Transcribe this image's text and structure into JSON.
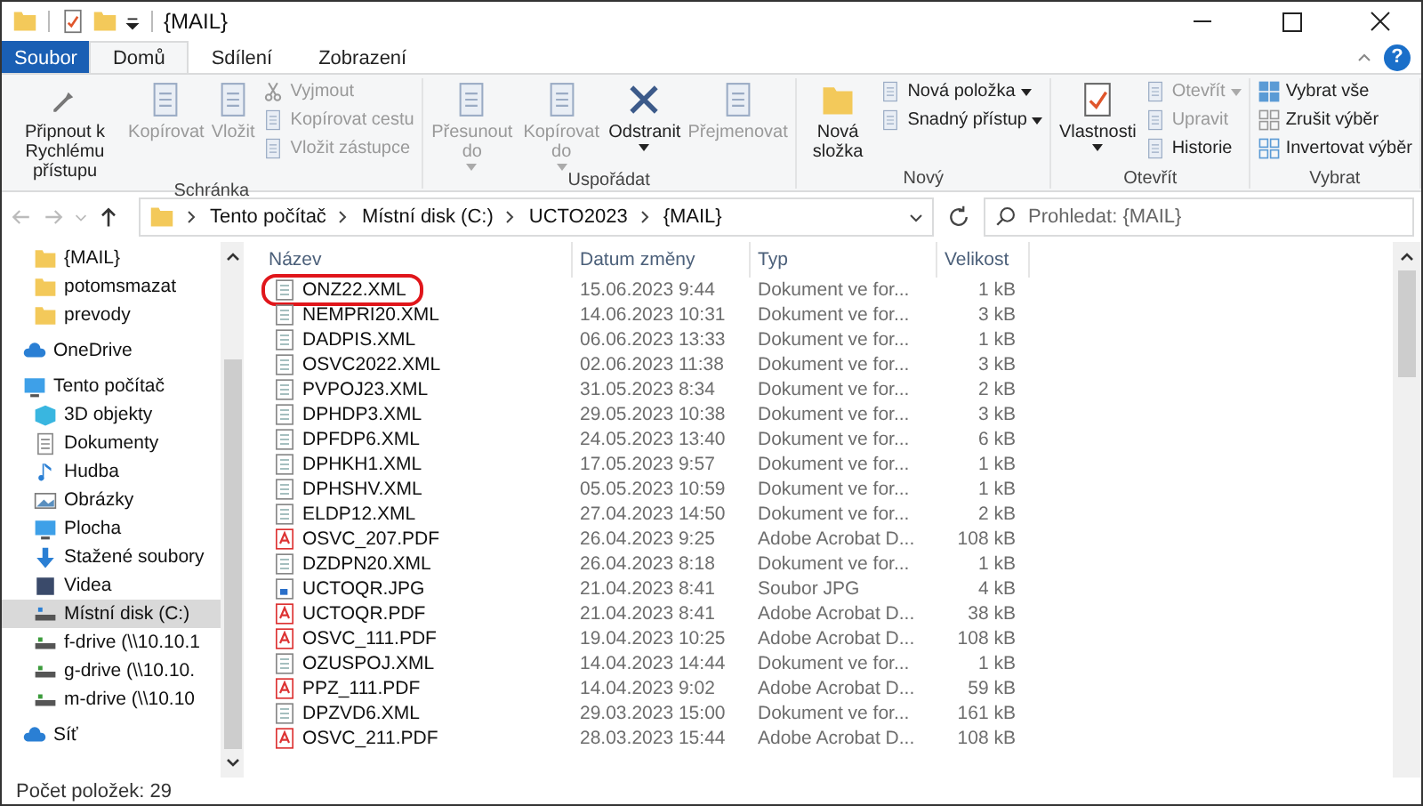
{
  "window": {
    "title": "{MAIL}"
  },
  "tabs": [
    {
      "label": "Soubor",
      "kind": "file",
      "selected": false
    },
    {
      "label": "Domů",
      "kind": "tab",
      "selected": true
    },
    {
      "label": "Sdílení",
      "kind": "tab",
      "selected": false
    },
    {
      "label": "Zobrazení",
      "kind": "tab",
      "selected": false
    }
  ],
  "help_button": "?",
  "ribbon": {
    "groups": [
      {
        "title": "Schránka",
        "items": [
          {
            "label": "Připnout k Rychlému přístupu",
            "kind": "large",
            "disabled": false,
            "dropdown": false
          },
          {
            "label": "Kopírovat",
            "kind": "large",
            "disabled": true,
            "dropdown": false
          },
          {
            "label": "Vložit",
            "kind": "large",
            "disabled": true,
            "dropdown": false
          },
          {
            "label": "Vyjmout",
            "kind": "small",
            "disabled": true,
            "dropdown": false
          },
          {
            "label": "Kopírovat cestu",
            "kind": "small",
            "disabled": true,
            "dropdown": false
          },
          {
            "label": "Vložit zástupce",
            "kind": "small",
            "disabled": true,
            "dropdown": false
          }
        ]
      },
      {
        "title": "Uspořádat",
        "items": [
          {
            "label": "Přesunout do",
            "kind": "large",
            "disabled": true,
            "dropdown": true
          },
          {
            "label": "Kopírovat do",
            "kind": "large",
            "disabled": true,
            "dropdown": true
          },
          {
            "label": "Odstranit",
            "kind": "large",
            "disabled": false,
            "dropdown": true
          },
          {
            "label": "Přejmenovat",
            "kind": "large",
            "disabled": true,
            "dropdown": false
          }
        ]
      },
      {
        "title": "Nový",
        "items": [
          {
            "label": "Nová složka",
            "kind": "large",
            "disabled": false,
            "dropdown": false
          },
          {
            "label": "Nová položka",
            "kind": "small",
            "disabled": false,
            "dropdown": true
          },
          {
            "label": "Snadný přístup",
            "kind": "small",
            "disabled": false,
            "dropdown": true
          }
        ]
      },
      {
        "title": "Otevřít",
        "items": [
          {
            "label": "Vlastnosti",
            "kind": "large",
            "disabled": false,
            "dropdown": true
          },
          {
            "label": "Otevřít",
            "kind": "small",
            "disabled": true,
            "dropdown": true
          },
          {
            "label": "Upravit",
            "kind": "small",
            "disabled": true,
            "dropdown": false
          },
          {
            "label": "Historie",
            "kind": "small",
            "disabled": false,
            "dropdown": false
          }
        ]
      },
      {
        "title": "Vybrat",
        "items": [
          {
            "label": "Vybrat vše",
            "kind": "small",
            "disabled": false,
            "dropdown": false
          },
          {
            "label": "Zrušit výběr",
            "kind": "small",
            "disabled": false,
            "dropdown": false
          },
          {
            "label": "Invertovat výběr",
            "kind": "small",
            "disabled": false,
            "dropdown": false
          }
        ]
      }
    ]
  },
  "address_bar": {
    "path": [
      "Tento počítač",
      "Místní disk (C:)",
      "UCTO2023",
      "{MAIL}"
    ]
  },
  "search": {
    "placeholder": "Prohledat: {MAIL}"
  },
  "sidebar": {
    "items": [
      {
        "label": "{MAIL}",
        "selected": false
      },
      {
        "label": "potomsmazat",
        "selected": false
      },
      {
        "label": "prevody",
        "selected": false
      },
      {
        "label": "OneDrive",
        "selected": false
      },
      {
        "label": "Tento počítač",
        "selected": false,
        "children": [
          {
            "label": "3D objekty",
            "selected": false
          },
          {
            "label": "Dokumenty",
            "selected": false
          },
          {
            "label": "Hudba",
            "selected": false
          },
          {
            "label": "Obrázky",
            "selected": false
          },
          {
            "label": "Plocha",
            "selected": false
          },
          {
            "label": "Stažené soubory",
            "selected": false
          },
          {
            "label": "Videa",
            "selected": false
          },
          {
            "label": "Místní disk (C:)",
            "selected": true
          },
          {
            "label": "f-drive (\\\\10.10.1",
            "selected": false
          },
          {
            "label": "g-drive (\\\\10.10.",
            "selected": false
          },
          {
            "label": "m-drive (\\\\10.10",
            "selected": false
          }
        ]
      },
      {
        "label": "Síť",
        "selected": false
      }
    ]
  },
  "table": {
    "columns": [
      "Název",
      "Datum změny",
      "Typ",
      "Velikost"
    ],
    "rows": [
      {
        "name": "ONZ22.XML",
        "date": "15.06.2023 9:44",
        "type": "Dokument ve for...",
        "size": "1 kB",
        "kind": "xml",
        "highlighted": true
      },
      {
        "name": "NEMPRI20.XML",
        "date": "14.06.2023 10:31",
        "type": "Dokument ve for...",
        "size": "3 kB",
        "kind": "xml",
        "highlighted": false
      },
      {
        "name": "DADPIS.XML",
        "date": "06.06.2023 13:33",
        "type": "Dokument ve for...",
        "size": "1 kB",
        "kind": "xml",
        "highlighted": false
      },
      {
        "name": "OSVC2022.XML",
        "date": "02.06.2023 11:38",
        "type": "Dokument ve for...",
        "size": "3 kB",
        "kind": "xml",
        "highlighted": false
      },
      {
        "name": "PVPOJ23.XML",
        "date": "31.05.2023 8:34",
        "type": "Dokument ve for...",
        "size": "2 kB",
        "kind": "xml",
        "highlighted": false
      },
      {
        "name": "DPHDP3.XML",
        "date": "29.05.2023 10:38",
        "type": "Dokument ve for...",
        "size": "3 kB",
        "kind": "xml",
        "highlighted": false
      },
      {
        "name": "DPFDP6.XML",
        "date": "24.05.2023 13:40",
        "type": "Dokument ve for...",
        "size": "6 kB",
        "kind": "xml",
        "highlighted": false
      },
      {
        "name": "DPHKH1.XML",
        "date": "17.05.2023 9:57",
        "type": "Dokument ve for...",
        "size": "1 kB",
        "kind": "xml",
        "highlighted": false
      },
      {
        "name": "DPHSHV.XML",
        "date": "05.05.2023 10:59",
        "type": "Dokument ve for...",
        "size": "1 kB",
        "kind": "xml",
        "highlighted": false
      },
      {
        "name": "ELDP12.XML",
        "date": "27.04.2023 14:50",
        "type": "Dokument ve for...",
        "size": "2 kB",
        "kind": "xml",
        "highlighted": false
      },
      {
        "name": "OSVC_207.PDF",
        "date": "26.04.2023 9:25",
        "type": "Adobe Acrobat D...",
        "size": "108 kB",
        "kind": "pdf",
        "highlighted": false
      },
      {
        "name": "DZDPN20.XML",
        "date": "26.04.2023 8:18",
        "type": "Dokument ve for...",
        "size": "1 kB",
        "kind": "xml",
        "highlighted": false
      },
      {
        "name": "UCTOQR.JPG",
        "date": "21.04.2023 8:41",
        "type": "Soubor JPG",
        "size": "4 kB",
        "kind": "jpg",
        "highlighted": false
      },
      {
        "name": "UCTOQR.PDF",
        "date": "21.04.2023 8:41",
        "type": "Adobe Acrobat D...",
        "size": "38 kB",
        "kind": "pdf",
        "highlighted": false
      },
      {
        "name": "OSVC_111.PDF",
        "date": "19.04.2023 10:25",
        "type": "Adobe Acrobat D...",
        "size": "108 kB",
        "kind": "pdf",
        "highlighted": false
      },
      {
        "name": "OZUSPOJ.XML",
        "date": "14.04.2023 14:44",
        "type": "Dokument ve for...",
        "size": "1 kB",
        "kind": "xml",
        "highlighted": false
      },
      {
        "name": "PPZ_111.PDF",
        "date": "14.04.2023 9:02",
        "type": "Adobe Acrobat D...",
        "size": "59 kB",
        "kind": "pdf",
        "highlighted": false
      },
      {
        "name": "DPZVD6.XML",
        "date": "29.03.2023 15:00",
        "type": "Dokument ve for...",
        "size": "161 kB",
        "kind": "xml",
        "highlighted": false
      },
      {
        "name": "OSVC_211.PDF",
        "date": "28.03.2023 15:44",
        "type": "Adobe Acrobat D...",
        "size": "108 kB",
        "kind": "pdf",
        "highlighted": false
      }
    ]
  },
  "status_bar": {
    "item_count": "Počet položek: 29"
  }
}
